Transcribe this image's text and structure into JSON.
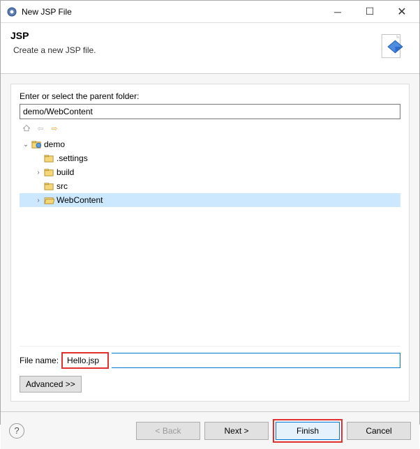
{
  "window": {
    "title": "New JSP File"
  },
  "banner": {
    "title": "JSP",
    "description": "Create a new JSP file."
  },
  "parent_folder": {
    "label": "Enter or select the parent folder:",
    "value": "demo/WebContent"
  },
  "tree": {
    "nodes": [
      {
        "label": "demo",
        "icon": "project",
        "depth": 0,
        "expanded": true,
        "selected": false
      },
      {
        "label": ".settings",
        "icon": "folder",
        "depth": 1,
        "expandable": false,
        "selected": false
      },
      {
        "label": "build",
        "icon": "folder",
        "depth": 1,
        "expandable": true,
        "selected": false
      },
      {
        "label": "src",
        "icon": "folder",
        "depth": 1,
        "expandable": false,
        "selected": false
      },
      {
        "label": "WebContent",
        "icon": "folder-open",
        "depth": 1,
        "expandable": true,
        "selected": true
      }
    ]
  },
  "file_name": {
    "label": "File name:",
    "value": "Hello.jsp"
  },
  "advanced_label": "Advanced >>",
  "buttons": {
    "back": "< Back",
    "next": "Next >",
    "finish": "Finish",
    "cancel": "Cancel"
  }
}
